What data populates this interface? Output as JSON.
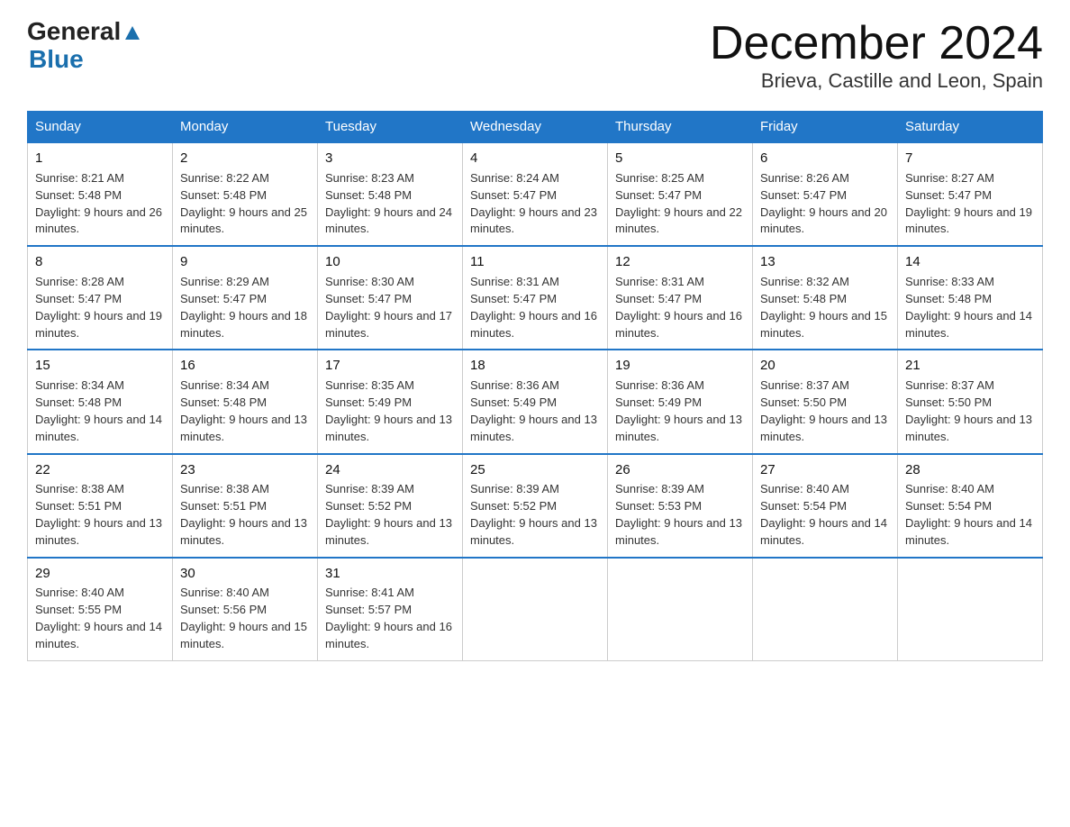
{
  "header": {
    "logo_general": "General",
    "logo_blue": "Blue",
    "month_title": "December 2024",
    "location": "Brieva, Castille and Leon, Spain"
  },
  "days_of_week": [
    "Sunday",
    "Monday",
    "Tuesday",
    "Wednesday",
    "Thursday",
    "Friday",
    "Saturday"
  ],
  "weeks": [
    [
      {
        "day": "1",
        "sunrise": "8:21 AM",
        "sunset": "5:48 PM",
        "daylight": "9 hours and 26 minutes."
      },
      {
        "day": "2",
        "sunrise": "8:22 AM",
        "sunset": "5:48 PM",
        "daylight": "9 hours and 25 minutes."
      },
      {
        "day": "3",
        "sunrise": "8:23 AM",
        "sunset": "5:48 PM",
        "daylight": "9 hours and 24 minutes."
      },
      {
        "day": "4",
        "sunrise": "8:24 AM",
        "sunset": "5:47 PM",
        "daylight": "9 hours and 23 minutes."
      },
      {
        "day": "5",
        "sunrise": "8:25 AM",
        "sunset": "5:47 PM",
        "daylight": "9 hours and 22 minutes."
      },
      {
        "day": "6",
        "sunrise": "8:26 AM",
        "sunset": "5:47 PM",
        "daylight": "9 hours and 20 minutes."
      },
      {
        "day": "7",
        "sunrise": "8:27 AM",
        "sunset": "5:47 PM",
        "daylight": "9 hours and 19 minutes."
      }
    ],
    [
      {
        "day": "8",
        "sunrise": "8:28 AM",
        "sunset": "5:47 PM",
        "daylight": "9 hours and 19 minutes."
      },
      {
        "day": "9",
        "sunrise": "8:29 AM",
        "sunset": "5:47 PM",
        "daylight": "9 hours and 18 minutes."
      },
      {
        "day": "10",
        "sunrise": "8:30 AM",
        "sunset": "5:47 PM",
        "daylight": "9 hours and 17 minutes."
      },
      {
        "day": "11",
        "sunrise": "8:31 AM",
        "sunset": "5:47 PM",
        "daylight": "9 hours and 16 minutes."
      },
      {
        "day": "12",
        "sunrise": "8:31 AM",
        "sunset": "5:47 PM",
        "daylight": "9 hours and 16 minutes."
      },
      {
        "day": "13",
        "sunrise": "8:32 AM",
        "sunset": "5:48 PM",
        "daylight": "9 hours and 15 minutes."
      },
      {
        "day": "14",
        "sunrise": "8:33 AM",
        "sunset": "5:48 PM",
        "daylight": "9 hours and 14 minutes."
      }
    ],
    [
      {
        "day": "15",
        "sunrise": "8:34 AM",
        "sunset": "5:48 PM",
        "daylight": "9 hours and 14 minutes."
      },
      {
        "day": "16",
        "sunrise": "8:34 AM",
        "sunset": "5:48 PM",
        "daylight": "9 hours and 13 minutes."
      },
      {
        "day": "17",
        "sunrise": "8:35 AM",
        "sunset": "5:49 PM",
        "daylight": "9 hours and 13 minutes."
      },
      {
        "day": "18",
        "sunrise": "8:36 AM",
        "sunset": "5:49 PM",
        "daylight": "9 hours and 13 minutes."
      },
      {
        "day": "19",
        "sunrise": "8:36 AM",
        "sunset": "5:49 PM",
        "daylight": "9 hours and 13 minutes."
      },
      {
        "day": "20",
        "sunrise": "8:37 AM",
        "sunset": "5:50 PM",
        "daylight": "9 hours and 13 minutes."
      },
      {
        "day": "21",
        "sunrise": "8:37 AM",
        "sunset": "5:50 PM",
        "daylight": "9 hours and 13 minutes."
      }
    ],
    [
      {
        "day": "22",
        "sunrise": "8:38 AM",
        "sunset": "5:51 PM",
        "daylight": "9 hours and 13 minutes."
      },
      {
        "day": "23",
        "sunrise": "8:38 AM",
        "sunset": "5:51 PM",
        "daylight": "9 hours and 13 minutes."
      },
      {
        "day": "24",
        "sunrise": "8:39 AM",
        "sunset": "5:52 PM",
        "daylight": "9 hours and 13 minutes."
      },
      {
        "day": "25",
        "sunrise": "8:39 AM",
        "sunset": "5:52 PM",
        "daylight": "9 hours and 13 minutes."
      },
      {
        "day": "26",
        "sunrise": "8:39 AM",
        "sunset": "5:53 PM",
        "daylight": "9 hours and 13 minutes."
      },
      {
        "day": "27",
        "sunrise": "8:40 AM",
        "sunset": "5:54 PM",
        "daylight": "9 hours and 14 minutes."
      },
      {
        "day": "28",
        "sunrise": "8:40 AM",
        "sunset": "5:54 PM",
        "daylight": "9 hours and 14 minutes."
      }
    ],
    [
      {
        "day": "29",
        "sunrise": "8:40 AM",
        "sunset": "5:55 PM",
        "daylight": "9 hours and 14 minutes."
      },
      {
        "day": "30",
        "sunrise": "8:40 AM",
        "sunset": "5:56 PM",
        "daylight": "9 hours and 15 minutes."
      },
      {
        "day": "31",
        "sunrise": "8:41 AM",
        "sunset": "5:57 PM",
        "daylight": "9 hours and 16 minutes."
      },
      null,
      null,
      null,
      null
    ]
  ]
}
